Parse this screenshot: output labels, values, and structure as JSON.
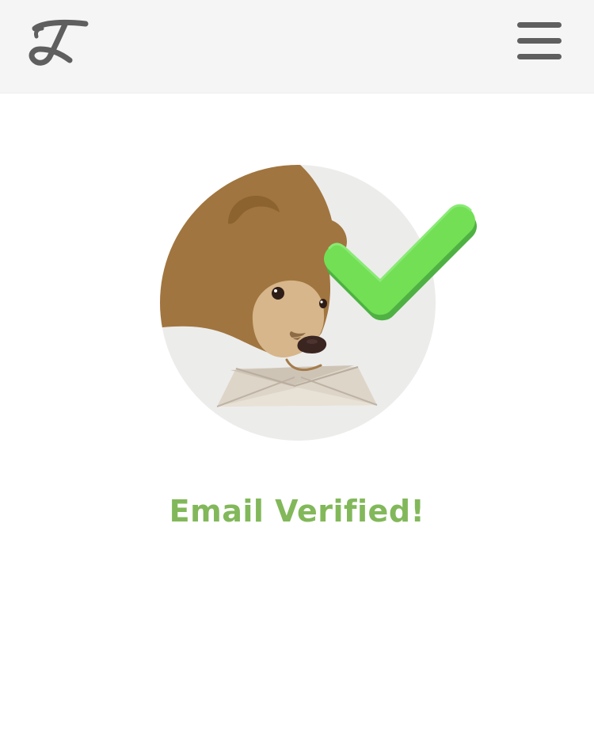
{
  "header": {
    "logo_icon": "tunnelbear-t-logo-icon",
    "menu_icon": "hamburger-menu-icon"
  },
  "main": {
    "illustration_icon": "bear-holding-envelope-with-checkmark-icon",
    "title": "Email Verified!"
  },
  "colors": {
    "header_background": "#f5f5f5",
    "icon_gray": "#5f5f5f",
    "success_green": "#82b85a",
    "check_green": "#6ed85a",
    "bear_brown": "#a1753f",
    "bear_muzzle": "#d6b68a"
  }
}
